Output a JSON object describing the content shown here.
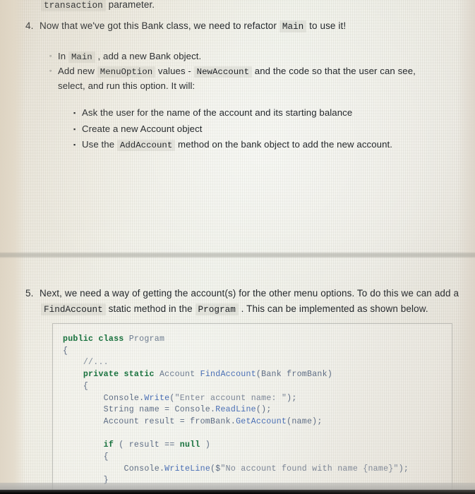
{
  "document": {
    "type": "programming-tutorial",
    "language": "C#",
    "top_partial_line": {
      "code": "transaction",
      "text": " parameter."
    },
    "items": [
      {
        "number": "4.",
        "parts": [
          {
            "t": "text",
            "v": "Now that we've got this Bank class, we need to refactor "
          },
          {
            "t": "code",
            "v": "Main"
          },
          {
            "t": "text",
            "v": " to use it!"
          }
        ],
        "sub_bullets": [
          {
            "marker": "◦",
            "parts": [
              {
                "t": "text",
                "v": "In "
              },
              {
                "t": "code",
                "v": "Main"
              },
              {
                "t": "text",
                "v": " , add a new Bank object."
              }
            ]
          },
          {
            "marker": "◦",
            "parts": [
              {
                "t": "text",
                "v": "Add new "
              },
              {
                "t": "code",
                "v": "MenuOption"
              },
              {
                "t": "text",
                "v": " values - "
              },
              {
                "t": "code",
                "v": "NewAccount"
              },
              {
                "t": "text",
                "v": " and the code so that the user can see,"
              }
            ],
            "continuation": "select, and run this option. It will:"
          }
        ],
        "sub_sub_bullets": [
          {
            "marker": "▪",
            "parts": [
              {
                "t": "text",
                "v": "Ask the user for the name of the account and its starting balance"
              }
            ]
          },
          {
            "marker": "▪",
            "parts": [
              {
                "t": "text",
                "v": "Create a new Account object"
              }
            ]
          },
          {
            "marker": "▪",
            "parts": [
              {
                "t": "text",
                "v": "Use the "
              },
              {
                "t": "code",
                "v": "AddAccount"
              },
              {
                "t": "text",
                "v": " method on the bank object to add the new account."
              }
            ]
          }
        ]
      },
      {
        "number": "5.",
        "parts": [
          {
            "t": "text",
            "v": "Next, we need a way of getting the account(s) for the other menu options. To do this we can add a"
          }
        ],
        "line2_parts": [
          {
            "t": "code",
            "v": "FindAccount"
          },
          {
            "t": "text",
            "v": " static method in the "
          },
          {
            "t": "code",
            "v": "Program"
          },
          {
            "t": "text",
            "v": " . This can be implemented as shown below."
          }
        ]
      }
    ],
    "code_block": {
      "language": "csharp",
      "truncated": true,
      "lines": [
        [
          {
            "t": "k",
            "v": "public class "
          },
          {
            "t": "ty",
            "v": "Program"
          }
        ],
        [
          {
            "t": "p",
            "v": "{"
          }
        ],
        [
          {
            "t": "p",
            "v": "    "
          },
          {
            "t": "cm",
            "v": "//..."
          }
        ],
        [
          {
            "t": "p",
            "v": "    "
          },
          {
            "t": "k",
            "v": "private static "
          },
          {
            "t": "ty",
            "v": "Account "
          },
          {
            "t": "fn",
            "v": "FindAccount"
          },
          {
            "t": "p",
            "v": "(Bank fromBank)"
          }
        ],
        [
          {
            "t": "p",
            "v": "    {"
          }
        ],
        [
          {
            "t": "p",
            "v": "        Console."
          },
          {
            "t": "fn",
            "v": "Write"
          },
          {
            "t": "p",
            "v": "("
          },
          {
            "t": "st",
            "v": "\"Enter account name: \""
          },
          {
            "t": "p",
            "v": ");"
          }
        ],
        [
          {
            "t": "p",
            "v": "        String name = Console."
          },
          {
            "t": "fn",
            "v": "ReadLine"
          },
          {
            "t": "p",
            "v": "();"
          }
        ],
        [
          {
            "t": "p",
            "v": "        Account result = fromBank."
          },
          {
            "t": "fn",
            "v": "GetAccount"
          },
          {
            "t": "p",
            "v": "(name);"
          }
        ],
        [
          {
            "t": "p",
            "v": ""
          }
        ],
        [
          {
            "t": "p",
            "v": "        "
          },
          {
            "t": "k",
            "v": "if"
          },
          {
            "t": "p",
            "v": " ( result == "
          },
          {
            "t": "k",
            "v": "null"
          },
          {
            "t": "p",
            "v": " )"
          }
        ],
        [
          {
            "t": "p",
            "v": "        {"
          }
        ],
        [
          {
            "t": "p",
            "v": "            Console."
          },
          {
            "t": "fn",
            "v": "WriteLine"
          },
          {
            "t": "p",
            "v": "($"
          },
          {
            "t": "st",
            "v": "\"No account found with name {name}\""
          },
          {
            "t": "p",
            "v": ");"
          }
        ],
        [
          {
            "t": "p",
            "v": "        }"
          }
        ]
      ]
    }
  },
  "colors": {
    "page_background": "#eceae0",
    "left_margin": "#e0d7c7",
    "body_text": "#24282c",
    "code_text": "#5d6c84",
    "code_keyword": "#17713d",
    "code_type": "#6b7a8f",
    "code_function": "#4a6fb5",
    "code_string": "#7b8596",
    "code_comment": "#7d8a99",
    "inline_code_chip_bg": "rgba(170,170,162,0.20)",
    "divider_band": "#969690",
    "bottom_bar": "#141414"
  }
}
